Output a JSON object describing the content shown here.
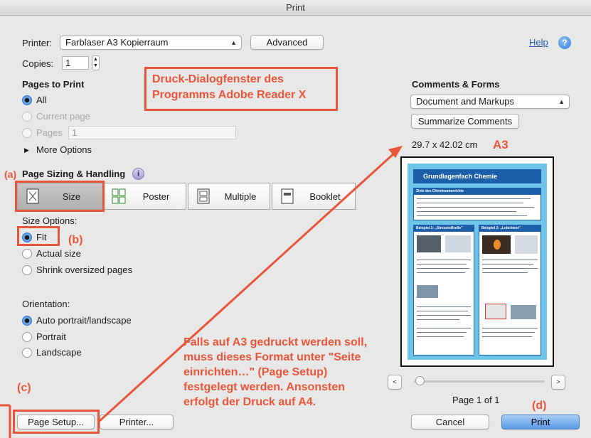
{
  "window": {
    "title": "Print"
  },
  "printer": {
    "label": "Printer:",
    "selected": "Farblaser A3 Kopierraum",
    "advanced": "Advanced",
    "help": "Help"
  },
  "copies": {
    "label": "Copies:",
    "value": "1"
  },
  "pages_to_print": {
    "heading": "Pages to Print",
    "all": "All",
    "current": "Current page",
    "pages": "Pages",
    "pages_value": "1",
    "more": "More Options"
  },
  "sizing": {
    "heading": "Page Sizing & Handling",
    "size": "Size",
    "poster": "Poster",
    "multiple": "Multiple",
    "booklet": "Booklet"
  },
  "size_options": {
    "heading": "Size Options:",
    "fit": "Fit",
    "actual": "Actual size",
    "shrink": "Shrink oversized pages"
  },
  "orientation": {
    "heading": "Orientation:",
    "auto": "Auto portrait/landscape",
    "portrait": "Portrait",
    "landscape": "Landscape"
  },
  "comments": {
    "heading": "Comments & Forms",
    "selected": "Document and Markups",
    "summarize": "Summarize Comments",
    "dimensions": "29.7 x 42.02 cm"
  },
  "preview": {
    "poster_title": "Grundlagenfach Chemie",
    "box1": "Ziele des Chemieunterrichts",
    "box2": "Beispiel 1: „Stresstoffzelle\"",
    "box3": "Beispiel 2: „Lebchtest\"",
    "page_label": "Page 1 of 1"
  },
  "footer": {
    "page_setup": "Page Setup...",
    "printer": "Printer...",
    "cancel": "Cancel",
    "print": "Print"
  },
  "annotations": {
    "title_line1": "Druck-Dialogfenster des",
    "title_line2": "Programms Adobe Reader X",
    "a": "(a)",
    "b": "(b)",
    "c": "(c)",
    "d": "(d)",
    "a3": "A3",
    "note_lines": [
      "Falls auf A3 gedruckt werden soll,",
      "muss dieses Format unter \"Seite",
      "einrichten…\" (Page Setup)",
      "festgelegt werden. Ansonsten",
      "erfolgt der Druck auf A4."
    ]
  },
  "colors": {
    "annotation": "#e8553a",
    "primary_button": "#5a9ae8",
    "poster_bg": "#6fc4ea"
  }
}
